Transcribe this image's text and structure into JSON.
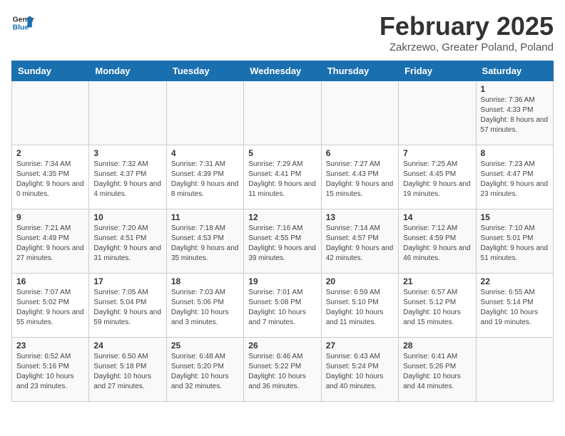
{
  "header": {
    "logo_line1": "General",
    "logo_line2": "Blue",
    "title": "February 2025",
    "subtitle": "Zakrzewo, Greater Poland, Poland"
  },
  "weekdays": [
    "Sunday",
    "Monday",
    "Tuesday",
    "Wednesday",
    "Thursday",
    "Friday",
    "Saturday"
  ],
  "weeks": [
    [
      {
        "day": "",
        "info": ""
      },
      {
        "day": "",
        "info": ""
      },
      {
        "day": "",
        "info": ""
      },
      {
        "day": "",
        "info": ""
      },
      {
        "day": "",
        "info": ""
      },
      {
        "day": "",
        "info": ""
      },
      {
        "day": "1",
        "info": "Sunrise: 7:36 AM\nSunset: 4:33 PM\nDaylight: 8 hours and 57 minutes."
      }
    ],
    [
      {
        "day": "2",
        "info": "Sunrise: 7:34 AM\nSunset: 4:35 PM\nDaylight: 9 hours and 0 minutes."
      },
      {
        "day": "3",
        "info": "Sunrise: 7:32 AM\nSunset: 4:37 PM\nDaylight: 9 hours and 4 minutes."
      },
      {
        "day": "4",
        "info": "Sunrise: 7:31 AM\nSunset: 4:39 PM\nDaylight: 9 hours and 8 minutes."
      },
      {
        "day": "5",
        "info": "Sunrise: 7:29 AM\nSunset: 4:41 PM\nDaylight: 9 hours and 11 minutes."
      },
      {
        "day": "6",
        "info": "Sunrise: 7:27 AM\nSunset: 4:43 PM\nDaylight: 9 hours and 15 minutes."
      },
      {
        "day": "7",
        "info": "Sunrise: 7:25 AM\nSunset: 4:45 PM\nDaylight: 9 hours and 19 minutes."
      },
      {
        "day": "8",
        "info": "Sunrise: 7:23 AM\nSunset: 4:47 PM\nDaylight: 9 hours and 23 minutes."
      }
    ],
    [
      {
        "day": "9",
        "info": "Sunrise: 7:21 AM\nSunset: 4:49 PM\nDaylight: 9 hours and 27 minutes."
      },
      {
        "day": "10",
        "info": "Sunrise: 7:20 AM\nSunset: 4:51 PM\nDaylight: 9 hours and 31 minutes."
      },
      {
        "day": "11",
        "info": "Sunrise: 7:18 AM\nSunset: 4:53 PM\nDaylight: 9 hours and 35 minutes."
      },
      {
        "day": "12",
        "info": "Sunrise: 7:16 AM\nSunset: 4:55 PM\nDaylight: 9 hours and 39 minutes."
      },
      {
        "day": "13",
        "info": "Sunrise: 7:14 AM\nSunset: 4:57 PM\nDaylight: 9 hours and 42 minutes."
      },
      {
        "day": "14",
        "info": "Sunrise: 7:12 AM\nSunset: 4:59 PM\nDaylight: 9 hours and 46 minutes."
      },
      {
        "day": "15",
        "info": "Sunrise: 7:10 AM\nSunset: 5:01 PM\nDaylight: 9 hours and 51 minutes."
      }
    ],
    [
      {
        "day": "16",
        "info": "Sunrise: 7:07 AM\nSunset: 5:02 PM\nDaylight: 9 hours and 55 minutes."
      },
      {
        "day": "17",
        "info": "Sunrise: 7:05 AM\nSunset: 5:04 PM\nDaylight: 9 hours and 59 minutes."
      },
      {
        "day": "18",
        "info": "Sunrise: 7:03 AM\nSunset: 5:06 PM\nDaylight: 10 hours and 3 minutes."
      },
      {
        "day": "19",
        "info": "Sunrise: 7:01 AM\nSunset: 5:08 PM\nDaylight: 10 hours and 7 minutes."
      },
      {
        "day": "20",
        "info": "Sunrise: 6:59 AM\nSunset: 5:10 PM\nDaylight: 10 hours and 11 minutes."
      },
      {
        "day": "21",
        "info": "Sunrise: 6:57 AM\nSunset: 5:12 PM\nDaylight: 10 hours and 15 minutes."
      },
      {
        "day": "22",
        "info": "Sunrise: 6:55 AM\nSunset: 5:14 PM\nDaylight: 10 hours and 19 minutes."
      }
    ],
    [
      {
        "day": "23",
        "info": "Sunrise: 6:52 AM\nSunset: 5:16 PM\nDaylight: 10 hours and 23 minutes."
      },
      {
        "day": "24",
        "info": "Sunrise: 6:50 AM\nSunset: 5:18 PM\nDaylight: 10 hours and 27 minutes."
      },
      {
        "day": "25",
        "info": "Sunrise: 6:48 AM\nSunset: 5:20 PM\nDaylight: 10 hours and 32 minutes."
      },
      {
        "day": "26",
        "info": "Sunrise: 6:46 AM\nSunset: 5:22 PM\nDaylight: 10 hours and 36 minutes."
      },
      {
        "day": "27",
        "info": "Sunrise: 6:43 AM\nSunset: 5:24 PM\nDaylight: 10 hours and 40 minutes."
      },
      {
        "day": "28",
        "info": "Sunrise: 6:41 AM\nSunset: 5:26 PM\nDaylight: 10 hours and 44 minutes."
      },
      {
        "day": "",
        "info": ""
      }
    ]
  ]
}
